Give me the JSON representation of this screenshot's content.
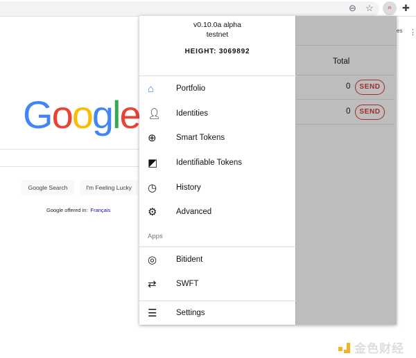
{
  "browser": {
    "zoom_icon": "zoom-out-icon",
    "star_icon": "star-icon",
    "extension_badge": "m",
    "puzzle_icon": "puzzle-icon"
  },
  "google": {
    "logo": "Google",
    "search_button": "Google Search",
    "lucky_button": "I'm Feeling Lucky",
    "offered_in": "Google offered in:",
    "language": "Français",
    "partial_text": "es"
  },
  "wallet": {
    "version": "v0.10.0a alpha",
    "network": "testnet",
    "height": "HEIGHT: 3069892",
    "menu": [
      {
        "label": "Portfolio",
        "icon": "home-icon"
      },
      {
        "label": "Identities",
        "icon": "person-icon"
      },
      {
        "label": "Smart Tokens",
        "icon": "globe-icon"
      },
      {
        "label": "Identifiable Tokens",
        "icon": "edit-box-icon"
      },
      {
        "label": "History",
        "icon": "clock-icon"
      },
      {
        "label": "Advanced",
        "icon": "gear-icon"
      }
    ],
    "apps_label": "Apps",
    "apps": [
      {
        "label": "Bitident",
        "icon": "fingerprint-icon"
      },
      {
        "label": "SWFT",
        "icon": "swap-icon"
      }
    ],
    "settings": {
      "label": "Settings",
      "icon": "sliders-icon"
    },
    "table": {
      "header": "Total",
      "rows": [
        {
          "total": "0",
          "action": "SEND"
        },
        {
          "total": "0",
          "action": "SEND"
        }
      ]
    },
    "colors": {
      "accent": "#a32a2a",
      "home_icon": "#4285f4"
    }
  },
  "watermark": "金色财经"
}
